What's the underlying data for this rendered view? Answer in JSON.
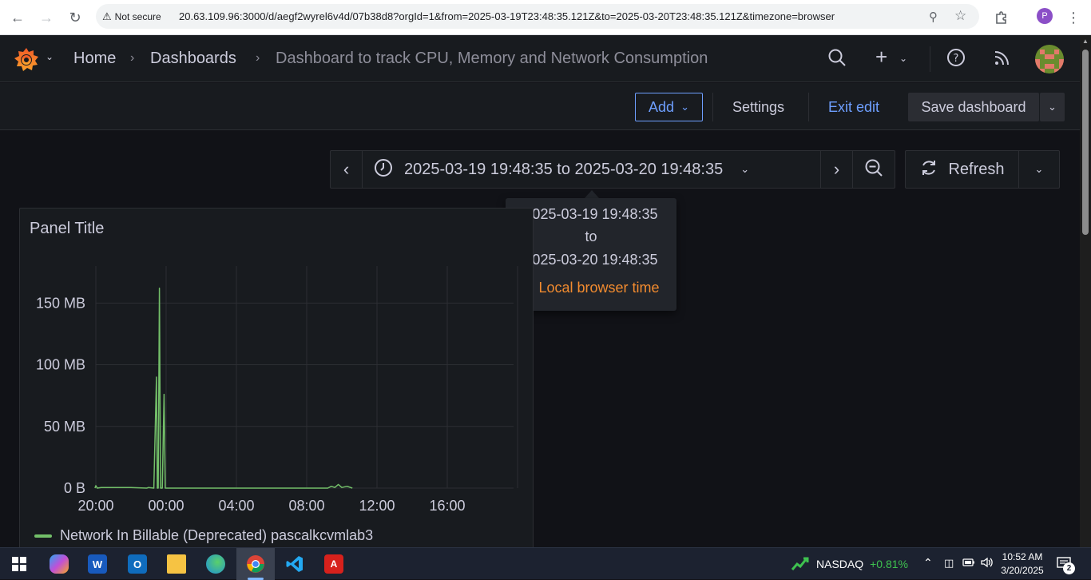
{
  "browser": {
    "security_label": "Not secure",
    "url": "20.63.109.96:3000/d/aegf2wyrel6v4d/07b38d8?orgId=1&from=2025-03-19T23:48:35.121Z&to=2025-03-20T23:48:35.121Z&timezone=browser",
    "profile_initial": "P"
  },
  "topnav": {
    "breadcrumbs": [
      "Home",
      "Dashboards",
      "Dashboard to track CPU, Memory and Network Consumption"
    ]
  },
  "toolbar": {
    "add_label": "Add",
    "settings_label": "Settings",
    "exit_edit_label": "Exit edit",
    "save_label": "Save dashboard"
  },
  "time_picker": {
    "range_label": "2025-03-19 19:48:35 to 2025-03-20 19:48:35",
    "refresh_label": "Refresh"
  },
  "tooltip": {
    "from": "2025-03-19 19:48:35",
    "to_word": "to",
    "to": "2025-03-20 19:48:35",
    "timezone": "Local browser time"
  },
  "panel": {
    "title": "Panel Title",
    "legend": "Network In Billable (Deprecated) pascalkcvmlab3"
  },
  "chart_data": {
    "type": "line",
    "title": "Panel Title",
    "xlabel": "",
    "ylabel": "",
    "x_ticks": [
      "20:00",
      "00:00",
      "04:00",
      "08:00",
      "12:00",
      "16:00"
    ],
    "y_ticks": [
      "0 B",
      "50 MB",
      "100 MB",
      "150 MB"
    ],
    "ylim": [
      0,
      180
    ],
    "grid": true,
    "legend_position": "bottom",
    "series_color": "#73bf69",
    "series": [
      {
        "name": "Network In Billable (Deprecated) pascalkcvmlab3",
        "points": [
          [
            -0.05,
            0
          ],
          [
            0.0,
            2
          ],
          [
            0.08,
            0
          ],
          [
            0.3,
            0.5
          ],
          [
            1.0,
            0.5
          ],
          [
            2.0,
            0.5
          ],
          [
            2.9,
            0
          ],
          [
            3.0,
            0.5
          ],
          [
            3.3,
            0
          ],
          [
            3.45,
            90
          ],
          [
            3.5,
            0
          ],
          [
            3.55,
            0
          ],
          [
            3.62,
            162
          ],
          [
            3.68,
            0
          ],
          [
            3.78,
            0
          ],
          [
            3.88,
            76
          ],
          [
            3.95,
            0
          ],
          [
            4.0,
            0
          ],
          [
            4.6,
            0
          ],
          [
            4.6,
            0
          ],
          [
            13.2,
            0
          ],
          [
            13.4,
            1.5
          ],
          [
            13.6,
            0.5
          ],
          [
            13.8,
            3
          ],
          [
            14.0,
            0.5
          ],
          [
            14.3,
            1.5
          ],
          [
            14.6,
            0
          ]
        ]
      }
    ]
  },
  "taskbar": {
    "nasdaq_label": "NASDAQ",
    "nasdaq_change": "+0.81%",
    "time": "10:52 AM",
    "date": "3/20/2025",
    "notification_count": "2"
  }
}
